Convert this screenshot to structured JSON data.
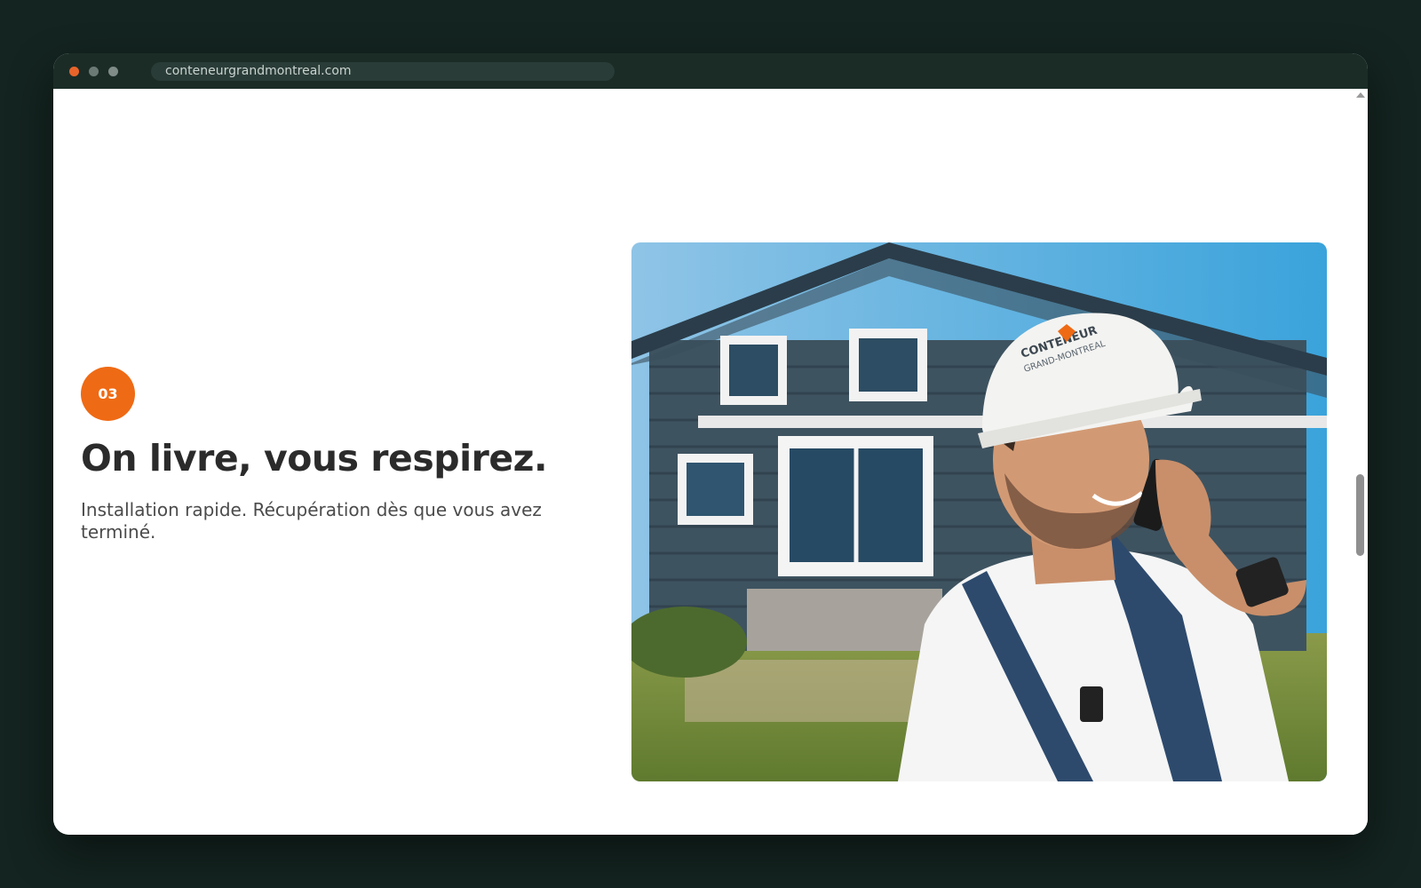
{
  "browser": {
    "url": "conteneurgrandmontreal.com"
  },
  "section": {
    "step_number": "03",
    "headline": "On livre, vous respirez.",
    "description": "Installation rapide. Récupération dès que vous avez terminé."
  },
  "photo": {
    "helmet_logo_line1": "CONTENEUR",
    "helmet_logo_line2": "GRAND-MONTREAL"
  },
  "colors": {
    "accent": "#ef6a14",
    "page_background": "#142420",
    "titlebar": "#1b2c27"
  }
}
